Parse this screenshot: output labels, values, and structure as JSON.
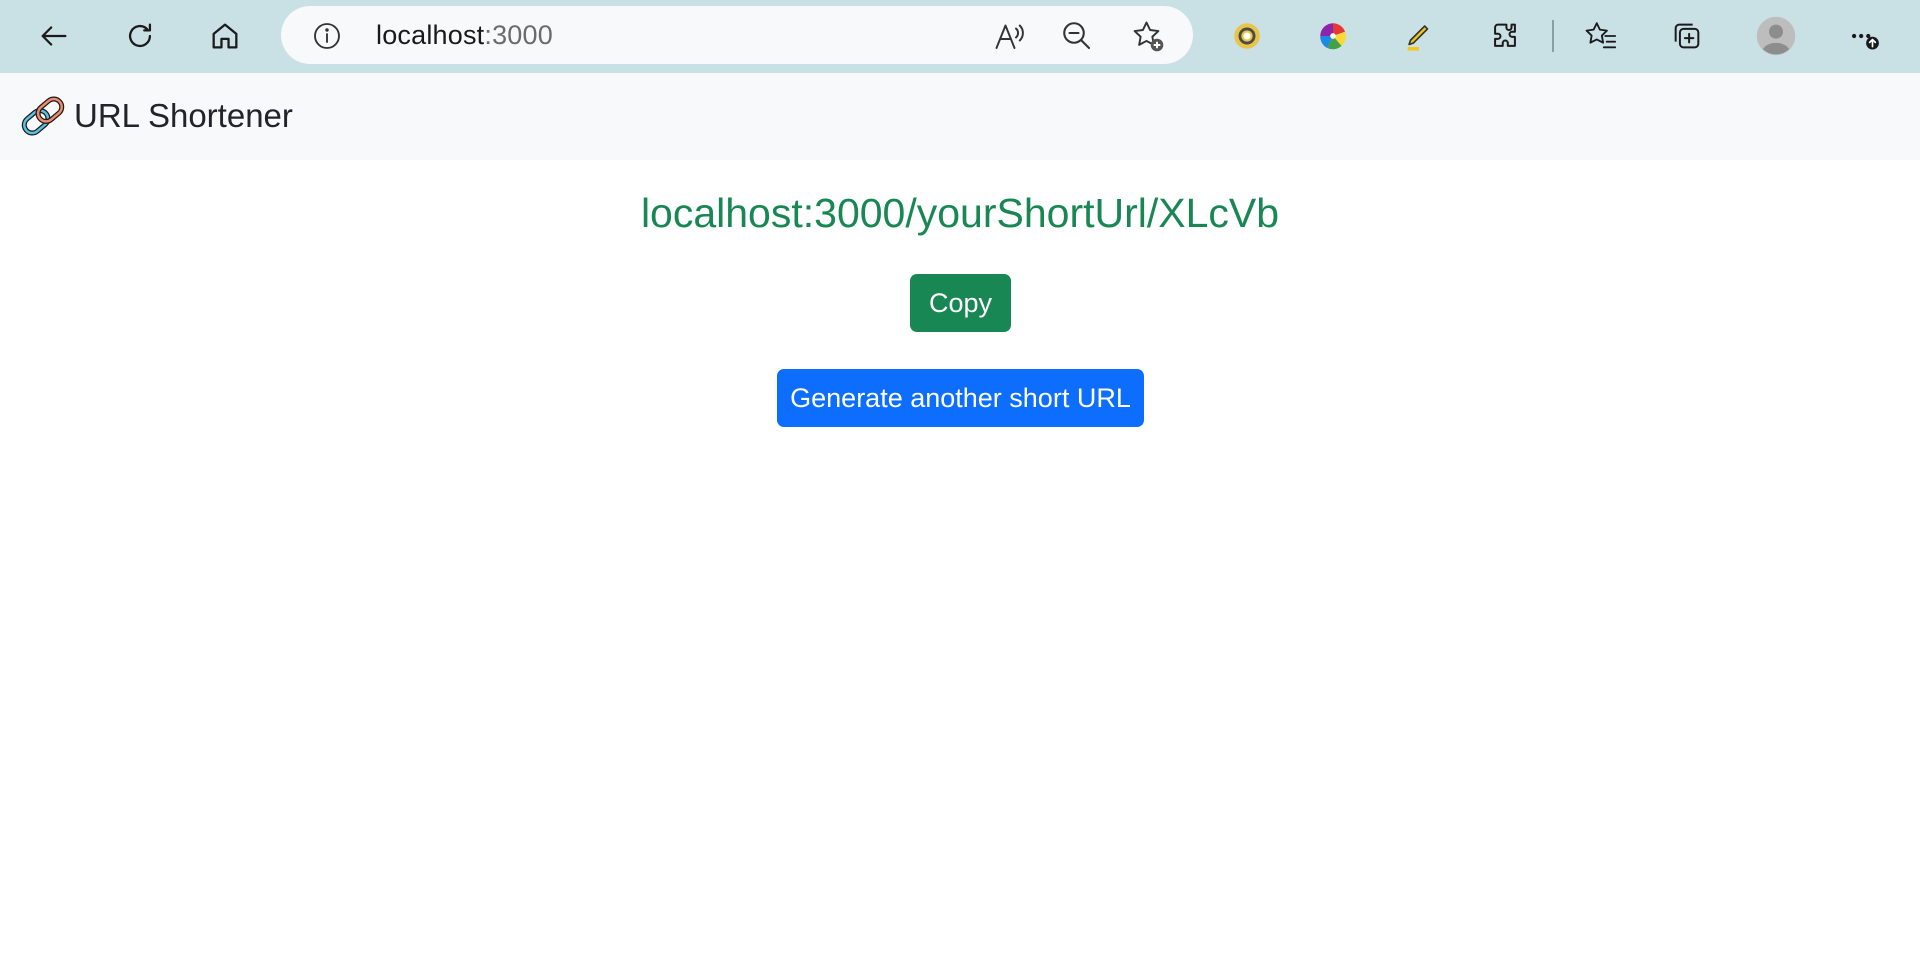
{
  "browser": {
    "address_host": "localhost",
    "address_port": ":3000",
    "icons": [
      "back-icon",
      "refresh-icon",
      "home-icon",
      "site-info-icon",
      "read-aloud-icon",
      "zoom-out-icon",
      "add-favorite-icon",
      "extension-circle-icon",
      "color-picker-icon",
      "highlighter-icon",
      "extensions-icon",
      "favorites-icon",
      "collections-icon",
      "profile-icon",
      "more-icon"
    ]
  },
  "navbar": {
    "brand_label": "URL Shortener",
    "brand_icon": "link-icon"
  },
  "main": {
    "short_url": "localhost:3000/yourShortUrl/XLcVb",
    "copy_label": "Copy",
    "generate_label": "Generate another short URL"
  },
  "colors": {
    "toolbar_bg": "#c9e0e5",
    "navbar_bg": "#f8f9fa",
    "success": "#198754",
    "primary": "#0d6efd"
  }
}
